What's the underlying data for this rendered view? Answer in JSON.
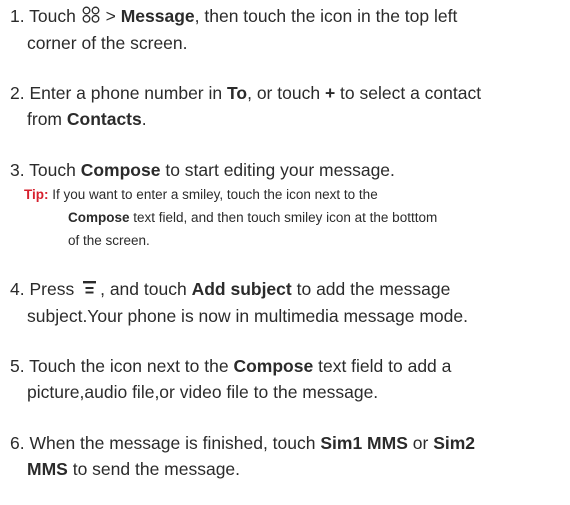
{
  "steps": [
    {
      "num": "1.",
      "t1": "Touch",
      "icon": "apps-grid-icon",
      "t2": ">",
      "b1": "Message",
      "t3": ", then touch the icon in the top left",
      "t4": "corner of the screen."
    },
    {
      "num": "2.",
      "t1": "Enter a phone number in",
      "b1": "To",
      "t2": ", or touch",
      "b2": "+",
      "t3": "to select a contact",
      "t4": "from",
      "b3": "Contacts",
      "t5": "."
    },
    {
      "num": "3.",
      "t1": "Touch",
      "b1": "Compose",
      "t2": "to start editing your message."
    },
    {
      "num": "4.",
      "t1": "Press",
      "icon": "menu-icon",
      "t2": ", and touch",
      "b1": "Add subject",
      "t3": "to add the message",
      "t4": "subject.Your phone is now in multimedia message mode."
    },
    {
      "num": "5.",
      "t1": "Touch the icon next to the",
      "b1": "Compose",
      "t2": "text field to add a",
      "t3": "picture,audio file,or video file to the message."
    },
    {
      "num": "6.",
      "t1": "When the message is finished, touch",
      "b1": "Sim1 MMS",
      "t2": "or",
      "b2": "Sim2",
      "b3": "MMS",
      "t3": "to send the message."
    }
  ],
  "tip": {
    "label": "Tip:",
    "t1": "If you want to enter a smiley, touch the icon next to the",
    "b1": "Compose",
    "t2": "text field, and then touch smiley icon at the botttom",
    "t3": "of the screen."
  },
  "colors": {
    "text": "#2b2b2b",
    "tip_label": "#d6202e"
  }
}
